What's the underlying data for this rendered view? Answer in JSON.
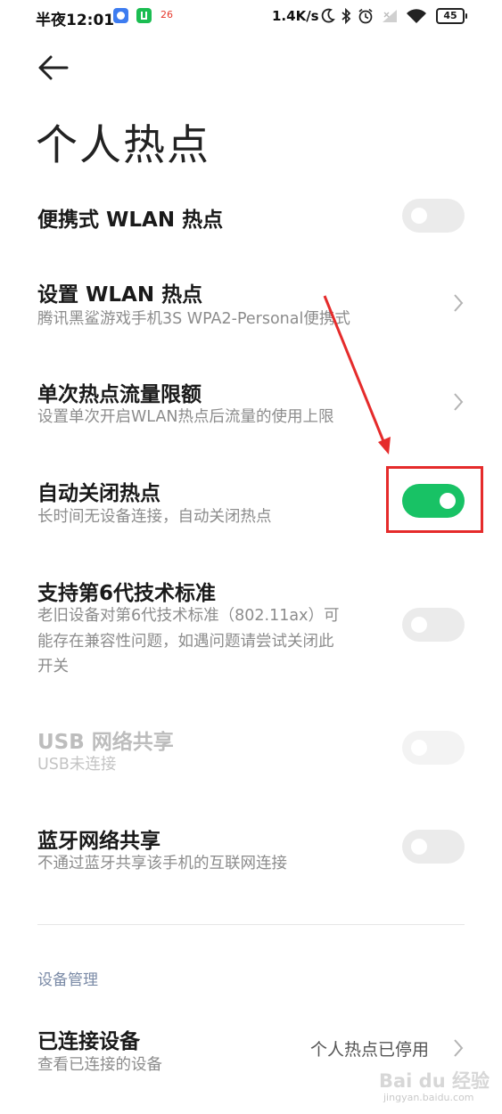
{
  "status_bar": {
    "time": "半夜12:01",
    "notif_badge": "26",
    "net_speed": "1.4K/s",
    "battery": "45"
  },
  "page": {
    "title": "个人热点"
  },
  "settings": [
    {
      "title": "便携式 WLAN 热点",
      "subtitle": "",
      "control": "toggle",
      "on": false,
      "enabled": true
    },
    {
      "title": "设置 WLAN 热点",
      "subtitle": "腾讯黑鲨游戏手机3S WPA2-Personal便携式",
      "control": "chevron"
    },
    {
      "title": "单次热点流量限额",
      "subtitle": "设置单次开启WLAN热点后流量的使用上限",
      "control": "chevron"
    },
    {
      "title": "自动关闭热点",
      "subtitle": "长时间无设备连接，自动关闭热点",
      "control": "toggle",
      "on": true,
      "enabled": true
    },
    {
      "title": "支持第6代技术标准",
      "subtitle_lines": [
        "老旧设备对第6代技术标准（802.11ax）可",
        "能存在兼容性问题，如遇问题请尝试关闭此",
        "开关"
      ],
      "control": "toggle",
      "on": false,
      "enabled": true
    },
    {
      "title": "USB 网络共享",
      "subtitle": "USB未连接",
      "control": "toggle",
      "on": false,
      "enabled": false
    },
    {
      "title": "蓝牙网络共享",
      "subtitle": "不通过蓝牙共享该手机的互联网连接",
      "control": "toggle",
      "on": false,
      "enabled": true
    }
  ],
  "device_section": {
    "header": "设备管理",
    "item": {
      "title": "已连接设备",
      "subtitle": "查看已连接的设备",
      "value": "个人热点已停用"
    }
  },
  "watermark": {
    "text": "Bai du 经验",
    "sub": "jingyan.baidu.com"
  },
  "colors": {
    "toggle_on": "#18c265",
    "annotation": "#e52b2b"
  }
}
